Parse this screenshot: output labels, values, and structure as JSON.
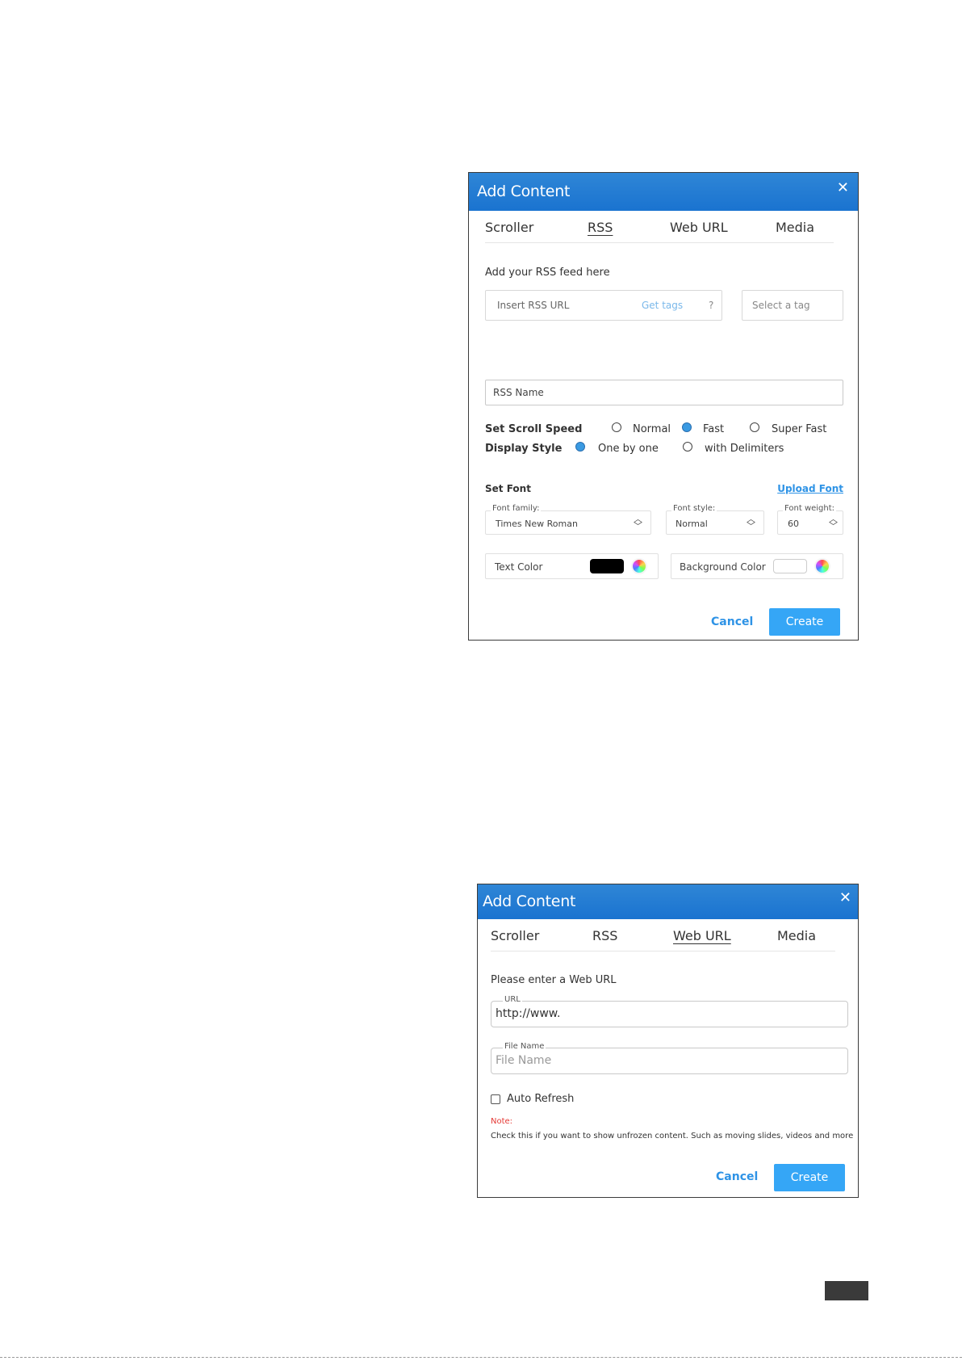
{
  "dialog1": {
    "title": "Add Content",
    "close_icon": "close-icon",
    "tabs": [
      {
        "label": "Scroller",
        "active": false
      },
      {
        "label": "RSS",
        "active": true
      },
      {
        "label": "Web URL",
        "active": false
      },
      {
        "label": "Media",
        "active": false
      }
    ],
    "intro": "Add your RSS feed here",
    "rss_url_placeholder": "Insert RSS URL",
    "get_tags_label": "Get tags",
    "help_glyph": "?",
    "tag_placeholder": "Select a tag",
    "rss_name_placeholder": "RSS Name",
    "scroll_speed": {
      "label": "Set Scroll Speed",
      "options": [
        {
          "label": "Normal",
          "selected": false
        },
        {
          "label": "Fast",
          "selected": true
        },
        {
          "label": "Super Fast",
          "selected": false
        }
      ]
    },
    "display_style": {
      "label": "Display Style",
      "options": [
        {
          "label": "One by one",
          "selected": true
        },
        {
          "label": "with Delimiters",
          "selected": false
        }
      ]
    },
    "set_font_label": "Set Font",
    "upload_font_label": "Upload Font",
    "font_family": {
      "legend": "Font family:",
      "value": "Times New Roman"
    },
    "font_style": {
      "legend": "Font style:",
      "value": "Normal"
    },
    "font_weight": {
      "legend": "Font weight:",
      "value": "60"
    },
    "text_color": {
      "label": "Text Color",
      "swatch": "#000000"
    },
    "background_color": {
      "label": "Background Color",
      "swatch": "#ffffff"
    },
    "cancel_label": "Cancel",
    "create_label": "Create"
  },
  "dialog2": {
    "title": "Add Content",
    "close_icon": "close-icon",
    "tabs": [
      {
        "label": "Scroller",
        "active": false
      },
      {
        "label": "RSS",
        "active": false
      },
      {
        "label": "Web URL",
        "active": true
      },
      {
        "label": "Media",
        "active": false
      }
    ],
    "intro": "Please enter a Web URL",
    "url_field": {
      "legend": "URL",
      "value": "http://www."
    },
    "file_name_field": {
      "legend": "File Name",
      "placeholder": "File Name"
    },
    "auto_refresh": {
      "label": "Auto Refresh",
      "checked": false
    },
    "note_label": "Note:",
    "note_text": "Check this if you want to show unfrozen content. Such as moving slides, videos and more",
    "cancel_label": "Cancel",
    "create_label": "Create"
  },
  "colors": {
    "header": "#1a73d0",
    "accent": "#35a6f6",
    "link": "#2e93e6",
    "note": "#e53935"
  }
}
